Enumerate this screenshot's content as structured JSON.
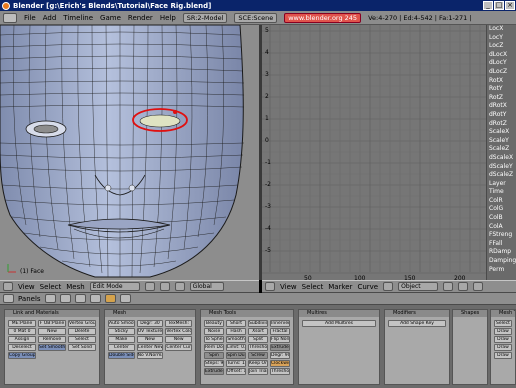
{
  "window": {
    "title": "Blender [g:\\Erich's Blends\\Tutorial\\Face Rig.blend]",
    "controls": [
      "_",
      "□",
      "×"
    ]
  },
  "menubar": {
    "items": [
      "File",
      "Add",
      "Timeline",
      "Game",
      "Render",
      "Help"
    ],
    "screen": "SR:2-Model",
    "scene": "SCE:Scene",
    "url": "www.blender.org 245",
    "stats": "Ve:4-270 | Ed:4-542 | Fa:1-271 |"
  },
  "viewport3d": {
    "object_label": "(1) Face",
    "header": {
      "menus": [
        "View",
        "Select",
        "Mesh"
      ],
      "mode": "Edit Mode",
      "orientation": "Global"
    }
  },
  "ipo": {
    "channels": [
      "LocX",
      "LocY",
      "LocZ",
      "dLocX",
      "dLocY",
      "dLocZ",
      "RotX",
      "RotY",
      "RotZ",
      "dRotX",
      "dRotY",
      "dRotZ",
      "ScaleX",
      "ScaleY",
      "ScaleZ",
      "dScaleX",
      "dScaleY",
      "dScaleZ",
      "Layer",
      "Time",
      "ColR",
      "ColG",
      "ColB",
      "ColA",
      "FStreng",
      "FFall",
      "RDamp",
      "Damping",
      "Perm"
    ],
    "y_ticks": [
      "5",
      "4",
      "3",
      "2",
      "1",
      "0",
      "-1",
      "-2",
      "-3",
      "-4",
      "-5"
    ],
    "x_ticks": [
      "50",
      "100",
      "150",
      "200"
    ],
    "header": {
      "menus": [
        "View",
        "Select",
        "Marker",
        "Curve"
      ],
      "type": "Object"
    }
  },
  "buttons": {
    "header_label": "Panels",
    "panels": [
      {
        "title": "Link and Materials",
        "buttons": [
          "ME:Plane",
          "F OB:Plane",
          "Vertex Groups",
          "0 Mat 0",
          "New",
          "Delete",
          "Assign",
          "Remove",
          "Select",
          "Deselect",
          "Set Smooth",
          "Set Solid",
          "Copy Group"
        ]
      },
      {
        "title": "Mesh",
        "buttons": [
          "Auto Smooth",
          "Degr: 30",
          "TexMesh:",
          "Sticky",
          "UV Texture",
          "Vertex Color",
          "Make",
          "New",
          "New",
          "Center",
          "Center New",
          "Center Cursor",
          "Double Sided",
          "No V.Normal Flip"
        ]
      },
      {
        "title": "Mesh Tools",
        "buttons": [
          "Beauty",
          "Short",
          "Subdivide",
          "Innervert",
          "Noise",
          "Hash",
          "Xsort",
          "Fractal",
          "To Sphere",
          "Smooth",
          "Split",
          "Flip Normals",
          "Rem Doubles",
          "Limit: 0.001",
          "Threshold: 0.010",
          "Extrude",
          "Spin",
          "Spin Dup",
          "Screw",
          "Degr: 90.00",
          "Steps: 9",
          "Turns: 1",
          "Keep Original",
          "Clockwise",
          "Extrude Dup",
          "Offset: 1.00",
          "Join Triangles",
          "Threshold: 0.800"
        ]
      },
      {
        "title": "Multires",
        "buttons": [
          "Add Multires"
        ]
      },
      {
        "title": "Modifiers",
        "buttons": [
          "Add Shape Key"
        ]
      },
      {
        "title": "Shapes",
        "buttons": []
      },
      {
        "title": "Mesh Tools 1",
        "buttons": [
          "Select",
          "Draw",
          "Draw",
          "Draw",
          "Draw"
        ]
      }
    ]
  },
  "colors": {
    "titlebar": "#0a246a",
    "mesh_face": "#98a6c8",
    "mesh_wire": "#1a1a1a",
    "selection": "#e01010",
    "panel_bg": "#a9a9a9"
  }
}
